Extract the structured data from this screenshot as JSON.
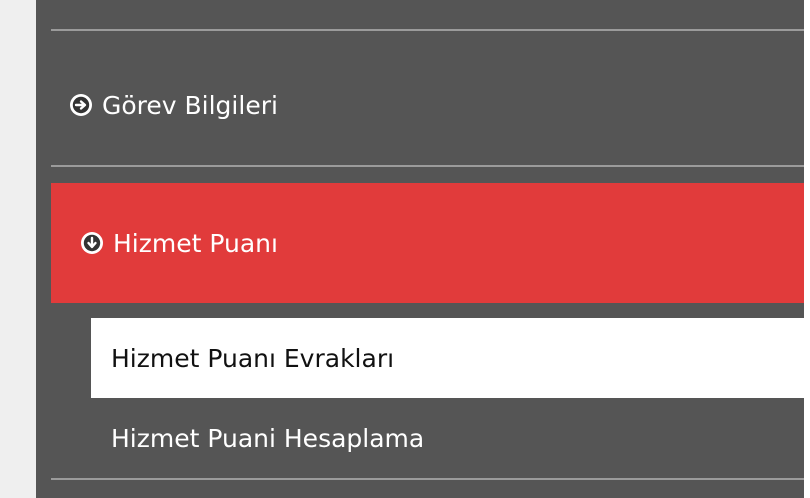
{
  "menu": {
    "items": [
      {
        "label": "Görev Bilgileri",
        "icon": "arrow-right-circle-icon"
      },
      {
        "label": "Hizmet Puanı",
        "icon": "arrow-down-circle-icon",
        "active": true
      }
    ],
    "sub_items": [
      {
        "label": "Hizmet Puanı Evrakları",
        "selected": true
      },
      {
        "label": "Hizmet Puani Hesaplama"
      }
    ]
  },
  "colors": {
    "menu_bg": "#555555",
    "active_bg": "#e13b3b",
    "selected_sub_bg": "#ffffff",
    "divider": "#9b9b9b"
  }
}
